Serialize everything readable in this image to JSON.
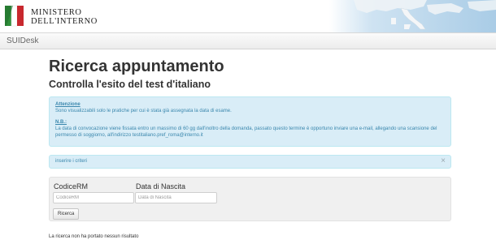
{
  "header": {
    "logo_line1": "MINISTERO",
    "logo_line2": "DELL'INTERNO",
    "emblem_icon": "italian-republic-emblem-icon",
    "banner_icon": "italy-map-banner"
  },
  "navbar": {
    "brand": "SUIDesk"
  },
  "main": {
    "title": "Ricerca appuntamento",
    "subtitle": "Controlla l'esito del test d'italiano"
  },
  "info_alert": {
    "attention_heading": "Attenzione",
    "attention_text": "Sono visualizzabili solo le pratiche per cui è stata già assegnata la data di esame.",
    "nb_heading": "N.B.:",
    "nb_text": "La data di convocazione viene fissata entro un massimo di 60 gg dall'inoltro della domanda, passato questo termine è opportuno inviare una e-mail, allegando una scansione del permesso di soggiorno, all'indirizzo testitaliano.pref_roma@interno.it"
  },
  "criteria_alert": {
    "text": "inserire i criteri",
    "close_glyph": "×"
  },
  "search_form": {
    "codice_label": "CodiceRM",
    "codice_placeholder": "CodiceRM",
    "codice_value": "",
    "data_label": "Data di Nascita",
    "data_placeholder": "Data di Nascita",
    "data_value": "",
    "submit_label": "Ricerca"
  },
  "results": {
    "message": "La ricerca non ha portato nessun risultato"
  },
  "colors": {
    "alert_bg": "#d9edf7",
    "alert_border": "#bce8f1",
    "alert_text": "#3a87ad",
    "well_bg": "#f0f0f0",
    "navbar_bg": "#f5f5f5"
  }
}
